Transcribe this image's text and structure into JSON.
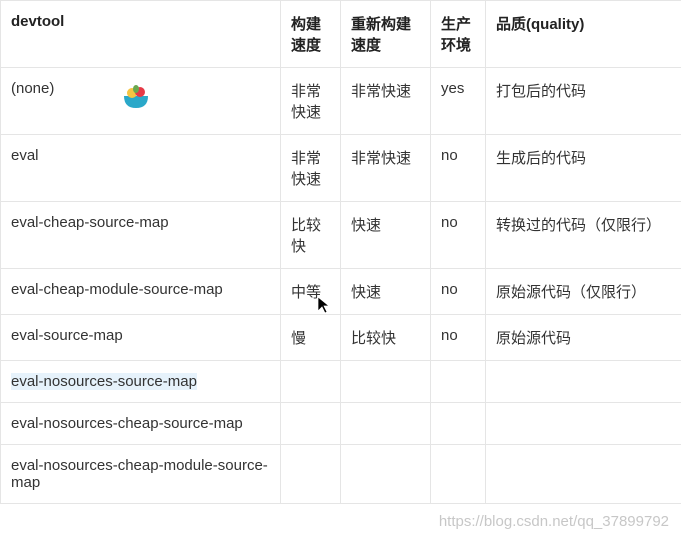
{
  "headers": {
    "devtool": "devtool",
    "build": "构建速度",
    "rebuild": "重新构建速度",
    "prod": "生产环境",
    "quality": "品质(quality)"
  },
  "rows": [
    {
      "devtool": "(none)",
      "build": "非常快速",
      "rebuild": "非常快速",
      "prod": "yes",
      "quality": "打包后的代码",
      "highlight": false
    },
    {
      "devtool": "eval",
      "build": "非常快速",
      "rebuild": "非常快速",
      "prod": "no",
      "quality": "生成后的代码",
      "highlight": false
    },
    {
      "devtool": "eval-cheap-source-map",
      "build": "比较快",
      "rebuild": "快速",
      "prod": "no",
      "quality": "转换过的代码（仅限行）",
      "highlight": false
    },
    {
      "devtool": "eval-cheap-module-source-map",
      "build": "中等",
      "rebuild": "快速",
      "prod": "no",
      "quality": "原始源代码（仅限行）",
      "highlight": false
    },
    {
      "devtool": "eval-source-map",
      "build": "慢",
      "rebuild": "比较快",
      "prod": "no",
      "quality": "原始源代码",
      "highlight": false
    },
    {
      "devtool": "eval-nosources-source-map",
      "build": "",
      "rebuild": "",
      "prod": "",
      "quality": "",
      "highlight": true
    },
    {
      "devtool": "eval-nosources-cheap-source-map",
      "build": "",
      "rebuild": "",
      "prod": "",
      "quality": "",
      "highlight": false
    },
    {
      "devtool": "eval-nosources-cheap-module-source-map",
      "build": "",
      "rebuild": "",
      "prod": "",
      "quality": "",
      "highlight": false
    }
  ],
  "watermark": "https://blog.csdn.net/qq_37899792",
  "icons": {
    "bowl": "fruit-bowl-icon",
    "cursor": "mouse-cursor-icon"
  },
  "chart_data": {
    "type": "table",
    "title": "",
    "columns": [
      "devtool",
      "构建速度",
      "重新构建速度",
      "生产环境",
      "品质(quality)"
    ],
    "rows": [
      [
        "(none)",
        "非常快速",
        "非常快速",
        "yes",
        "打包后的代码"
      ],
      [
        "eval",
        "非常快速",
        "非常快速",
        "no",
        "生成后的代码"
      ],
      [
        "eval-cheap-source-map",
        "比较快",
        "快速",
        "no",
        "转换过的代码（仅限行）"
      ],
      [
        "eval-cheap-module-source-map",
        "中等",
        "快速",
        "no",
        "原始源代码（仅限行）"
      ],
      [
        "eval-source-map",
        "慢",
        "比较快",
        "no",
        "原始源代码"
      ],
      [
        "eval-nosources-source-map",
        "",
        "",
        "",
        ""
      ],
      [
        "eval-nosources-cheap-source-map",
        "",
        "",
        "",
        ""
      ],
      [
        "eval-nosources-cheap-module-source-map",
        "",
        "",
        "",
        ""
      ]
    ]
  }
}
